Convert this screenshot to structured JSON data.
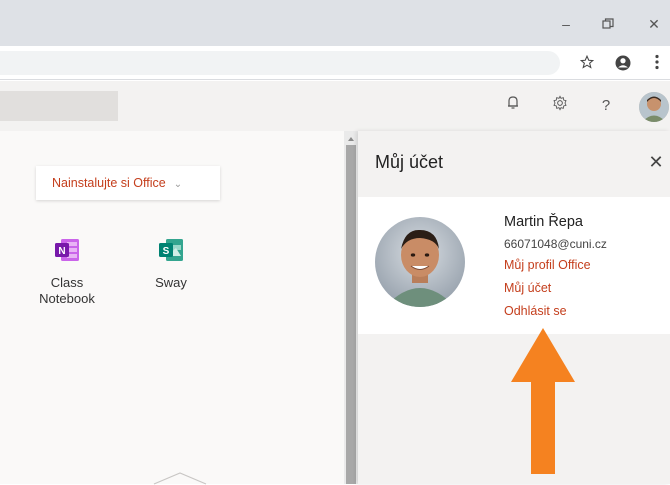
{
  "window": {
    "minimize_glyph": "–",
    "restore_glyph": "❐",
    "close_glyph": "✕"
  },
  "toolbar": {
    "star_icon": "star-icon",
    "profile_icon": "profile-icon",
    "menu_icon": "kebab-menu-icon"
  },
  "header": {
    "bell_icon": "bell-icon",
    "settings_icon": "gear-icon",
    "help_glyph": "?"
  },
  "main": {
    "install_label": "Nainstalujte si Office",
    "apps": [
      {
        "label_line1": "Class",
        "label_line2": "Notebook",
        "icon": "onenote-icon",
        "color": "#7719aa"
      },
      {
        "label_line1": "Sway",
        "label_line2": "",
        "icon": "sway-icon",
        "color": "#008272"
      }
    ]
  },
  "account_panel": {
    "title": "Můj účet",
    "close_glyph": "✕",
    "name": "Martin Řepa",
    "email": "66071048@cuni.cz",
    "links": [
      "Můj profil Office",
      "Můj účet",
      "Odhlásit se"
    ]
  },
  "colors": {
    "accent": "#c43e1c",
    "arrow": "#f58220"
  }
}
